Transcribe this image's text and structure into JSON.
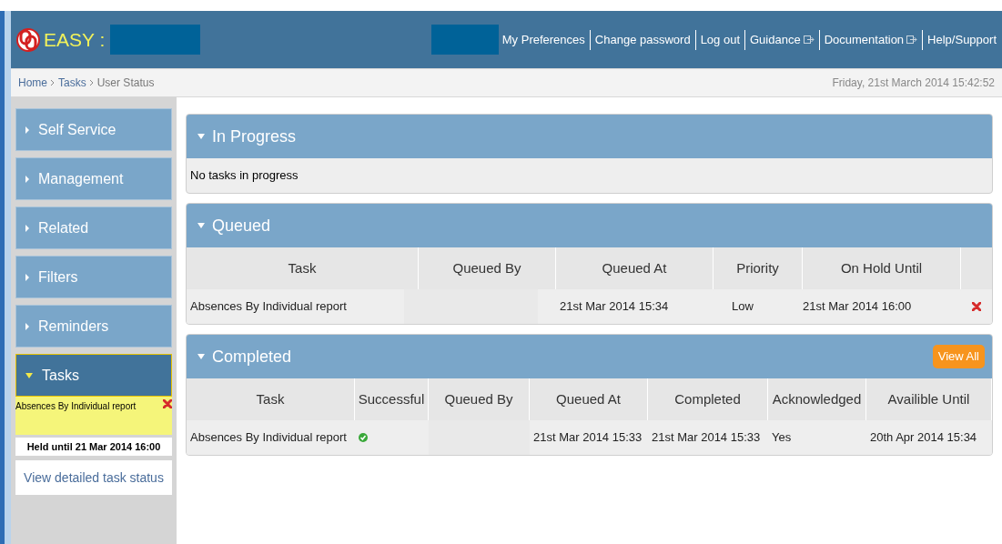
{
  "header": {
    "app_title": "EASY :",
    "links": [
      {
        "label": "My Preferences",
        "external": false
      },
      {
        "label": "Change password",
        "external": false
      },
      {
        "label": "Log out",
        "external": false
      },
      {
        "label": "Guidance",
        "external": true
      },
      {
        "label": "Documentation",
        "external": true
      },
      {
        "label": "Help/Support",
        "external": false
      }
    ]
  },
  "breadcrumb": {
    "items": [
      "Home",
      "Tasks"
    ],
    "current": "User Status",
    "datetime": "Friday, 21st March 2014 15:42:52"
  },
  "sidebar": {
    "items": [
      {
        "label": "Self Service",
        "expanded": false
      },
      {
        "label": "Management",
        "expanded": false
      },
      {
        "label": "Related",
        "expanded": false
      },
      {
        "label": "Filters",
        "expanded": false
      },
      {
        "label": "Reminders",
        "expanded": false
      },
      {
        "label": "Tasks",
        "expanded": true
      }
    ],
    "task_entry": {
      "name": "Absences By Individual report",
      "status": "Held until 21 Mar 2014 16:00"
    },
    "detail_link": "View detailed task status"
  },
  "in_progress": {
    "title": "In Progress",
    "expanded": true,
    "message": "No tasks in progress"
  },
  "queued": {
    "title": "Queued",
    "expanded": true,
    "columns": [
      "Task",
      "Queued By",
      "Queued At",
      "Priority",
      "On Hold Until"
    ],
    "rows": [
      {
        "task": "Absences By Individual report",
        "queued_at": "21st Mar 2014 15:34",
        "priority": "Low",
        "on_hold_until": "21st Mar 2014 16:00"
      }
    ]
  },
  "completed": {
    "title": "Completed",
    "expanded": true,
    "view_all": "View All",
    "columns": [
      "Task",
      "Successful",
      "Queued By",
      "Queued At",
      "Completed",
      "Acknowledged",
      "Availible Until"
    ],
    "rows": [
      {
        "task": "Absences By Individual report",
        "successful": true,
        "queued_at": "21st Mar 2014 15:33",
        "completed": "21st Mar 2014 15:33",
        "acknowledged": "Yes",
        "available_until": "20th Apr 2014 15:34"
      }
    ]
  }
}
